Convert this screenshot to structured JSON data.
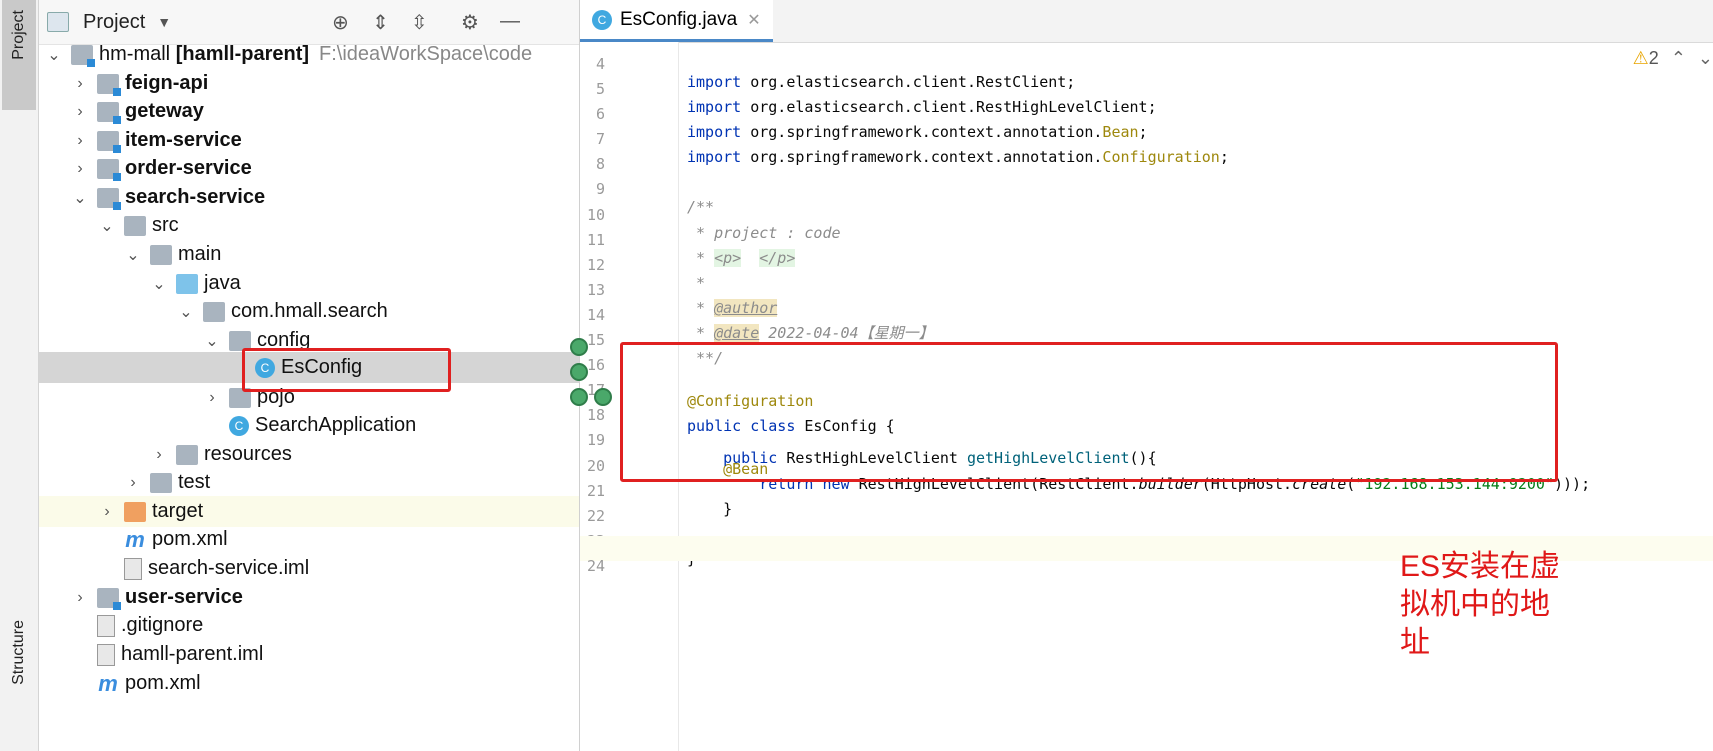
{
  "tool_strip": {
    "project_label": "Project",
    "structure_label": "Structure"
  },
  "project_panel": {
    "title": "Project",
    "tree": [
      {
        "label": "hm-mall",
        "suffix": "[hamll-parent]",
        "path": "F:\\ideaWorkSpace\\code"
      },
      {
        "label": "feign-api"
      },
      {
        "label": "geteway"
      },
      {
        "label": "item-service"
      },
      {
        "label": "order-service"
      },
      {
        "label": "search-service"
      },
      {
        "label": "src"
      },
      {
        "label": "main"
      },
      {
        "label": "java"
      },
      {
        "label": "com.hmall.search"
      },
      {
        "label": "config"
      },
      {
        "label": "EsConfig"
      },
      {
        "label": "pojo"
      },
      {
        "label": "SearchApplication"
      },
      {
        "label": "resources"
      },
      {
        "label": "test"
      },
      {
        "label": "target"
      },
      {
        "label": "pom.xml"
      },
      {
        "label": "search-service.iml"
      },
      {
        "label": "user-service"
      },
      {
        "label": ".gitignore"
      },
      {
        "label": "hamll-parent.iml"
      },
      {
        "label": "pom.xml"
      }
    ]
  },
  "editor": {
    "tab_label": "EsConfig.java",
    "warning_count": "2",
    "lines": {
      "l4": {
        "n": "4",
        "a": "import ",
        "b": "org.elasticsearch.client.RestClient;"
      },
      "l5": {
        "n": "5",
        "a": "import ",
        "b": "org.elasticsearch.client.RestHighLevelClient;"
      },
      "l6": {
        "n": "6",
        "a": "import ",
        "b": "org.springframework.context.annotation.",
        "c": "Bean",
        "d": ";"
      },
      "l7": {
        "n": "7",
        "a": "import ",
        "b": "org.springframework.context.annotation.",
        "c": "Configuration",
        "d": ";"
      },
      "l8": {
        "n": "8"
      },
      "l9": {
        "n": "9",
        "a": "/**"
      },
      "l10": {
        "n": "10",
        "a": " * project : code"
      },
      "l11": {
        "n": "11",
        "a": " * ",
        "b": "<p>",
        "c": "  ",
        "d": "</p>"
      },
      "l12": {
        "n": "12",
        "a": " *"
      },
      "l13": {
        "n": "13",
        "a": " * ",
        "b": "@author"
      },
      "l14": {
        "n": "14",
        "a": " * ",
        "b": "@date",
        "c": " 2022-04-04【星期一】"
      },
      "l15": {
        "n": "15",
        "a": " **/"
      },
      "l16": {
        "n": "16",
        "a": "@Configuration"
      },
      "l17": {
        "n": "17",
        "a": "public class ",
        "b": "EsConfig {"
      },
      "l18": {
        "n": "18",
        "a": "    @Bean"
      },
      "l19": {
        "n": "19",
        "a": "    public ",
        "b": "RestHighLevelClient ",
        "c": "getHighLevelClient",
        "d": "(){"
      },
      "l20": {
        "n": "20",
        "a": "        return new ",
        "b": "RestHighLevelClient(RestClient.",
        "c": "builder",
        "d": "(HttpHost.",
        "e": "create",
        "f": "(",
        "g": "\"192.168.153.144:9200\"",
        "h": ")));"
      },
      "l21": {
        "n": "21",
        "a": "    }"
      },
      "l22": {
        "n": "22"
      },
      "l23": {
        "n": "23",
        "a": "}"
      },
      "l24": {
        "n": "24"
      }
    }
  },
  "annotation_note": "ES安装在虚拟机中的地址"
}
